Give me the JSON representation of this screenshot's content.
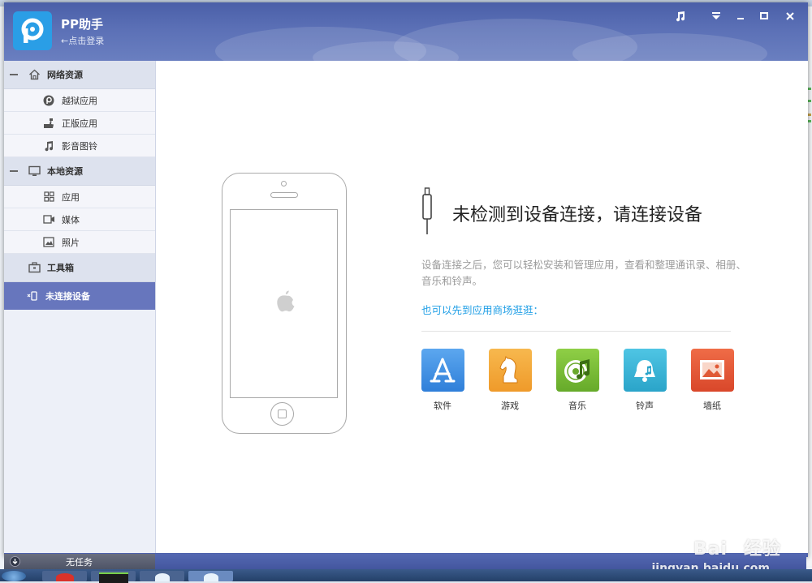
{
  "app": {
    "title": "PP助手",
    "login_link": "←点击登录"
  },
  "sidebar": {
    "sections": [
      {
        "label": "网络资源",
        "icon": "home-icon"
      },
      {
        "label": "本地资源",
        "icon": "monitor-icon"
      },
      {
        "label": "工具箱",
        "icon": "toolbox-icon"
      }
    ],
    "network_items": [
      {
        "label": "越狱应用",
        "icon": "pp-logo-icon"
      },
      {
        "label": "正版应用",
        "icon": "hand-icon"
      },
      {
        "label": "影音图铃",
        "icon": "music-note-icon"
      }
    ],
    "local_items": [
      {
        "label": "应用",
        "icon": "grid-icon"
      },
      {
        "label": "媒体",
        "icon": "video-camera-icon"
      },
      {
        "label": "照片",
        "icon": "picture-icon"
      }
    ],
    "device": {
      "label": "未连接设备",
      "icon": "device-disconnected-icon"
    },
    "task_status": "无任务"
  },
  "main": {
    "headline": "未检测到设备连接，请连接设备",
    "description": "设备连接之后，您可以轻松安装和管理应用，查看和整理通讯录、相册、音乐和铃声。",
    "store_link": "也可以先到应用商场逛逛：",
    "store_items": [
      {
        "label": "软件",
        "color": "#3d8fe3"
      },
      {
        "label": "游戏",
        "color": "#f3a43a"
      },
      {
        "label": "音乐",
        "color": "#7cbf3a"
      },
      {
        "label": "铃声",
        "color": "#3bb6d8"
      },
      {
        "label": "墙纸",
        "color": "#e8583a"
      }
    ]
  },
  "watermark": {
    "brand": "Bai",
    "brand_cn": "经验",
    "url": "jingyan.baidu.com"
  },
  "colors": {
    "titlebar": "#5568b0",
    "sidebar_active": "#6776bd",
    "link": "#1e9ee6"
  }
}
